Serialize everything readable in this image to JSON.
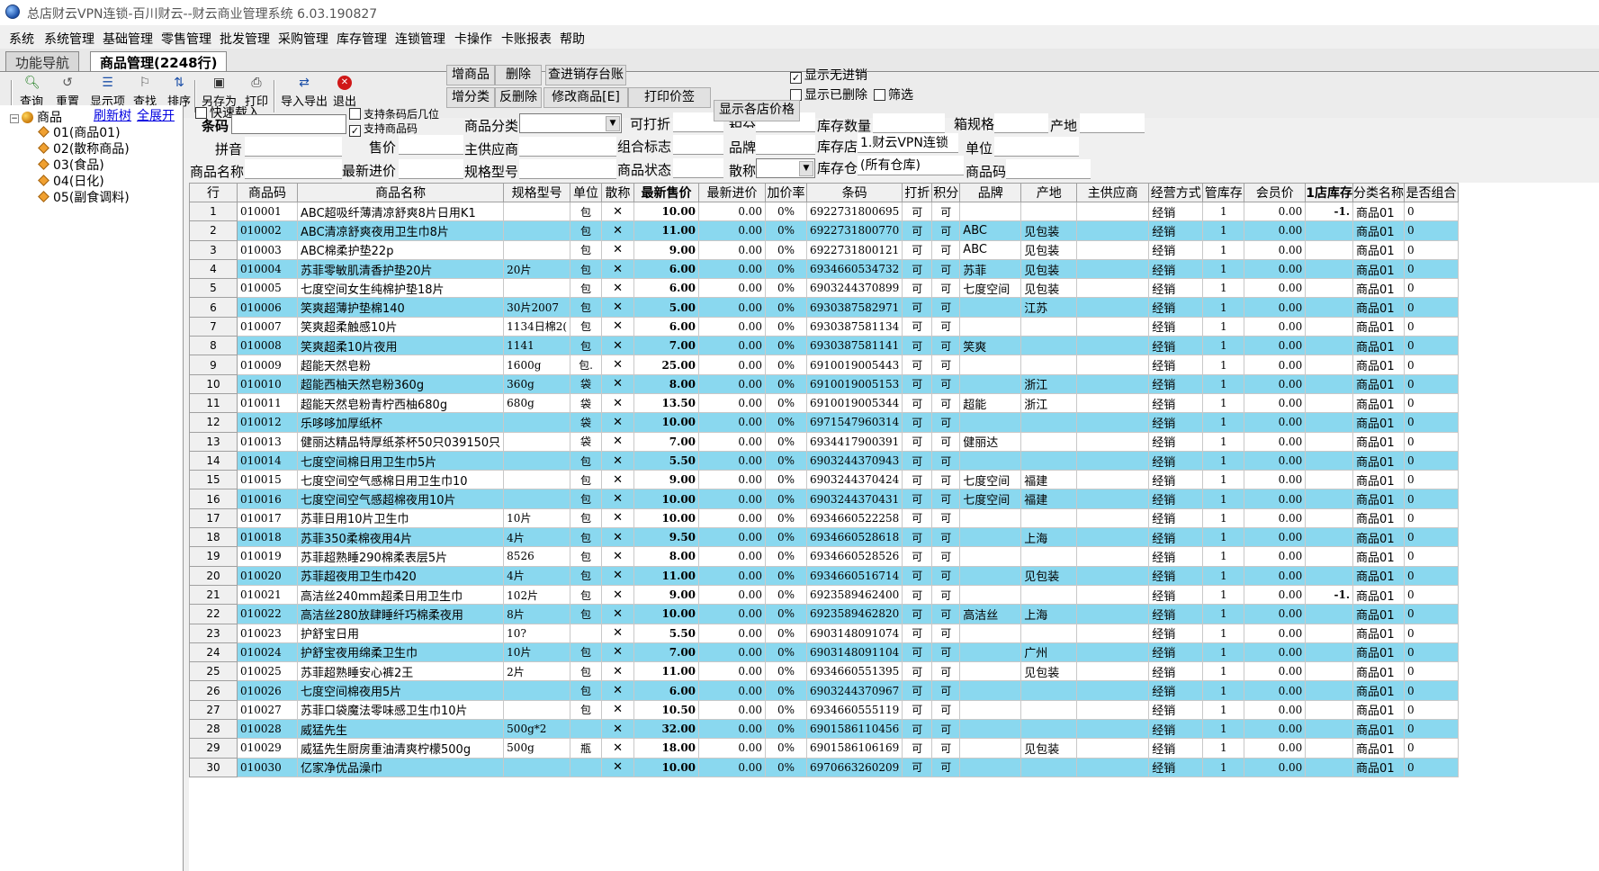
{
  "window": {
    "title": "总店财云VPN连锁-百川财云--财云商业管理系统 6.03.190827"
  },
  "menu": [
    "系统",
    "系统管理",
    "基础管理",
    "零售管理",
    "批发管理",
    "采购管理",
    "库存管理",
    "连锁管理",
    "卡操作",
    "卡账报表",
    "帮助"
  ],
  "tabs": {
    "nav": "功能导航",
    "goods": "商品管理(2248行)"
  },
  "toolbar": {
    "query": "查询",
    "reset": "重置",
    "show_items": "显示项",
    "find": "查找",
    "sort": "排序",
    "save_as": "另存为",
    "print": "打印",
    "import_export": "导入导出",
    "exit": "退出"
  },
  "actions": {
    "add_goods": "增商品",
    "delete": "删除",
    "query_ledger": "查进销存台账",
    "add_category": "增分类",
    "undelete": "反删除",
    "edit_goods": "修改商品[E]",
    "print_price_tag": "打印价签",
    "show_store_prices": "显示各店价格"
  },
  "options": {
    "show_no_purchase": "显示无进销",
    "show_deleted": "显示已删除",
    "filter": "筛选",
    "quick_load": "快速载入",
    "support_barcode_digits": "支持条码后几位",
    "support_goods_code": "支持商品码"
  },
  "tree": {
    "refresh": "刷新树",
    "expand_all": "全展开",
    "root": "商品",
    "items": [
      "01(商品01)",
      "02(散称商品)",
      "03(食品)",
      "04(日化)",
      "05(副食调料)"
    ]
  },
  "filters": {
    "barcode": "条码",
    "spec_name": "拼音",
    "goods_name": "商品名称",
    "sale_price": "售价",
    "latest_purchase_price": "最新进价",
    "category": "商品分类",
    "supplier": "主供应商",
    "spec_model": "规格型号",
    "discountable": "可打折",
    "combo_flag": "组合标志",
    "goods_status": "商品状态",
    "points": "积分",
    "brand": "品牌",
    "bulk": "散称",
    "stock_qty": "库存数量",
    "stock_store": "库存店",
    "stock_store_value": "1.财云VPN连锁",
    "warehouse": "库存仓",
    "warehouse_value": "(所有仓库)",
    "box_spec": "箱规格",
    "unit": "单位",
    "goods_code": "商品码",
    "origin": "产地"
  },
  "columns": [
    "行",
    "商品码",
    "商品名称",
    "规格型号",
    "单位",
    "散称",
    "最新售价",
    "最新进价",
    "加价率",
    "条码",
    "打折",
    "积分",
    "品牌",
    "产地",
    "主供应商",
    "经营方式",
    "管库存",
    "会员价",
    "1店库存",
    "分类名称",
    "是否组合"
  ],
  "rows": [
    [
      "1",
      "010001",
      "ABC超吸纤薄清凉舒爽8片日用K1",
      "",
      "包",
      "✕",
      "10.00",
      "0.00",
      "0%",
      "6922731800695",
      "可",
      "可",
      "",
      "",
      "",
      "经销",
      "1",
      "0.00",
      "-1.",
      "商品01",
      "0"
    ],
    [
      "2",
      "010002",
      "ABC清凉舒爽夜用卫生巾8片",
      "",
      "包",
      "✕",
      "11.00",
      "0.00",
      "0%",
      "6922731800770",
      "可",
      "可",
      "ABC",
      "见包装",
      "",
      "经销",
      "1",
      "0.00",
      "",
      "商品01",
      "0"
    ],
    [
      "3",
      "010003",
      "ABC棉柔护垫22p",
      "",
      "包",
      "✕",
      "9.00",
      "0.00",
      "0%",
      "6922731800121",
      "可",
      "可",
      "ABC",
      "见包装",
      "",
      "经销",
      "1",
      "0.00",
      "",
      "商品01",
      "0"
    ],
    [
      "4",
      "010004",
      "苏菲零敏肌清香护垫20片",
      "20片",
      "包",
      "✕",
      "6.00",
      "0.00",
      "0%",
      "6934660534732",
      "可",
      "可",
      "苏菲",
      "见包装",
      "",
      "经销",
      "1",
      "0.00",
      "",
      "商品01",
      "0"
    ],
    [
      "5",
      "010005",
      "七度空间女生纯棉护垫18片",
      "",
      "包",
      "✕",
      "6.00",
      "0.00",
      "0%",
      "6903244370899",
      "可",
      "可",
      "七度空间",
      "见包装",
      "",
      "经销",
      "1",
      "0.00",
      "",
      "商品01",
      "0"
    ],
    [
      "6",
      "010006",
      "笑爽超薄护垫棉140",
      "30片2007",
      "包",
      "✕",
      "5.00",
      "0.00",
      "0%",
      "6930387582971",
      "可",
      "可",
      "",
      "江苏",
      "",
      "经销",
      "1",
      "0.00",
      "",
      "商品01",
      "0"
    ],
    [
      "7",
      "010007",
      "笑爽超柔触感10片",
      "1134日棉2(",
      "包",
      "✕",
      "6.00",
      "0.00",
      "0%",
      "6930387581134",
      "可",
      "可",
      "",
      "",
      "",
      "经销",
      "1",
      "0.00",
      "",
      "商品01",
      "0"
    ],
    [
      "8",
      "010008",
      "笑爽超柔10片夜用",
      "1141",
      "包",
      "✕",
      "7.00",
      "0.00",
      "0%",
      "6930387581141",
      "可",
      "可",
      "笑爽",
      "",
      "",
      "经销",
      "1",
      "0.00",
      "",
      "商品01",
      "0"
    ],
    [
      "9",
      "010009",
      "超能天然皂粉",
      "1600g",
      "包.",
      "✕",
      "25.00",
      "0.00",
      "0%",
      "6910019005443",
      "可",
      "可",
      "",
      "",
      "",
      "经销",
      "1",
      "0.00",
      "",
      "商品01",
      "0"
    ],
    [
      "10",
      "010010",
      "超能西柚天然皂粉360g",
      "360g",
      "袋",
      "✕",
      "8.00",
      "0.00",
      "0%",
      "6910019005153",
      "可",
      "可",
      "",
      "浙江",
      "",
      "经销",
      "1",
      "0.00",
      "",
      "商品01",
      "0"
    ],
    [
      "11",
      "010011",
      "超能天然皂粉青柠西柚680g",
      "680g",
      "袋",
      "✕",
      "13.50",
      "0.00",
      "0%",
      "6910019005344",
      "可",
      "可",
      "超能",
      "浙江",
      "",
      "经销",
      "1",
      "0.00",
      "",
      "商品01",
      "0"
    ],
    [
      "12",
      "010012",
      "乐哆哆加厚纸杯",
      "",
      "袋",
      "✕",
      "10.00",
      "0.00",
      "0%",
      "6971547960314",
      "可",
      "可",
      "",
      "",
      "",
      "经销",
      "1",
      "0.00",
      "",
      "商品01",
      "0"
    ],
    [
      "13",
      "010013",
      "健丽达精品特厚纸茶杯50只039150只",
      "",
      "袋",
      "✕",
      "7.00",
      "0.00",
      "0%",
      "6934417900391",
      "可",
      "可",
      "健丽达",
      "",
      "",
      "经销",
      "1",
      "0.00",
      "",
      "商品01",
      "0"
    ],
    [
      "14",
      "010014",
      "七度空间棉日用卫生巾5片",
      "",
      "包",
      "✕",
      "5.50",
      "0.00",
      "0%",
      "6903244370943",
      "可",
      "可",
      "",
      "",
      "",
      "经销",
      "1",
      "0.00",
      "",
      "商品01",
      "0"
    ],
    [
      "15",
      "010015",
      "七度空间空气感棉日用卫生巾10",
      "",
      "包",
      "✕",
      "9.00",
      "0.00",
      "0%",
      "6903244370424",
      "可",
      "可",
      "七度空间",
      "福建",
      "",
      "经销",
      "1",
      "0.00",
      "",
      "商品01",
      "0"
    ],
    [
      "16",
      "010016",
      "七度空间空气感超棉夜用10片",
      "",
      "包",
      "✕",
      "10.00",
      "0.00",
      "0%",
      "6903244370431",
      "可",
      "可",
      "七度空间",
      "福建",
      "",
      "经销",
      "1",
      "0.00",
      "",
      "商品01",
      "0"
    ],
    [
      "17",
      "010017",
      "苏菲日用10片卫生巾",
      "10片",
      "包",
      "✕",
      "10.00",
      "0.00",
      "0%",
      "6934660522258",
      "可",
      "可",
      "",
      "",
      "",
      "经销",
      "1",
      "0.00",
      "",
      "商品01",
      "0"
    ],
    [
      "18",
      "010018",
      "苏菲350柔棉夜用4片",
      "4片",
      "包",
      "✕",
      "9.50",
      "0.00",
      "0%",
      "6934660528618",
      "可",
      "可",
      "",
      "上海",
      "",
      "经销",
      "1",
      "0.00",
      "",
      "商品01",
      "0"
    ],
    [
      "19",
      "010019",
      "苏菲超熟睡290棉柔表层5片",
      "8526",
      "包",
      "✕",
      "8.00",
      "0.00",
      "0%",
      "6934660528526",
      "可",
      "可",
      "",
      "",
      "",
      "经销",
      "1",
      "0.00",
      "",
      "商品01",
      "0"
    ],
    [
      "20",
      "010020",
      "苏菲超夜用卫生巾420",
      "4片",
      "包",
      "✕",
      "11.00",
      "0.00",
      "0%",
      "6934660516714",
      "可",
      "可",
      "",
      "见包装",
      "",
      "经销",
      "1",
      "0.00",
      "",
      "商品01",
      "0"
    ],
    [
      "21",
      "010021",
      "高洁丝240mm超柔日用卫生巾",
      "102片",
      "包",
      "✕",
      "9.00",
      "0.00",
      "0%",
      "6923589462400",
      "可",
      "可",
      "",
      "",
      "",
      "经销",
      "1",
      "0.00",
      "-1.",
      "商品01",
      "0"
    ],
    [
      "22",
      "010022",
      "高洁丝280放肆睡纤巧棉柔夜用",
      "8片",
      "包",
      "✕",
      "10.00",
      "0.00",
      "0%",
      "6923589462820",
      "可",
      "可",
      "高洁丝",
      "上海",
      "",
      "经销",
      "1",
      "0.00",
      "",
      "商品01",
      "0"
    ],
    [
      "23",
      "010023",
      "护舒宝日用",
      "10?",
      "",
      "✕",
      "5.50",
      "0.00",
      "0%",
      "6903148091074",
      "可",
      "可",
      "",
      "",
      "",
      "经销",
      "1",
      "0.00",
      "",
      "商品01",
      "0"
    ],
    [
      "24",
      "010024",
      "护舒宝夜用绵柔卫生巾",
      "10片",
      "包",
      "✕",
      "7.00",
      "0.00",
      "0%",
      "6903148091104",
      "可",
      "可",
      "",
      "广州",
      "",
      "经销",
      "1",
      "0.00",
      "",
      "商品01",
      "0"
    ],
    [
      "25",
      "010025",
      "苏菲超熟睡安心裤2王",
      "2片",
      "包",
      "✕",
      "11.00",
      "0.00",
      "0%",
      "6934660551395",
      "可",
      "可",
      "",
      "见包装",
      "",
      "经销",
      "1",
      "0.00",
      "",
      "商品01",
      "0"
    ],
    [
      "26",
      "010026",
      "七度空间棉夜用5片",
      "",
      "包",
      "✕",
      "6.00",
      "0.00",
      "0%",
      "6903244370967",
      "可",
      "可",
      "",
      "",
      "",
      "经销",
      "1",
      "0.00",
      "",
      "商品01",
      "0"
    ],
    [
      "27",
      "010027",
      "苏菲口袋魔法零味感卫生巾10片",
      "",
      "包",
      "✕",
      "10.50",
      "0.00",
      "0%",
      "6934660555119",
      "可",
      "可",
      "",
      "",
      "",
      "经销",
      "1",
      "0.00",
      "",
      "商品01",
      "0"
    ],
    [
      "28",
      "010028",
      "威猛先生",
      "500g*2",
      "",
      "✕",
      "32.00",
      "0.00",
      "0%",
      "6901586110456",
      "可",
      "可",
      "",
      "",
      "",
      "经销",
      "1",
      "0.00",
      "",
      "商品01",
      "0"
    ],
    [
      "29",
      "010029",
      "威猛先生厨房重油清爽柠檬500g",
      "500g",
      "瓶",
      "✕",
      "18.00",
      "0.00",
      "0%",
      "6901586106169",
      "可",
      "可",
      "",
      "见包装",
      "",
      "经销",
      "1",
      "0.00",
      "",
      "商品01",
      "0"
    ],
    [
      "30",
      "010030",
      "亿家净优品澡巾",
      "",
      "",
      "✕",
      "10.00",
      "0.00",
      "0%",
      "6970663260209",
      "可",
      "可",
      "",
      "",
      "",
      "经销",
      "1",
      "0.00",
      "",
      "商品01",
      "0"
    ]
  ]
}
